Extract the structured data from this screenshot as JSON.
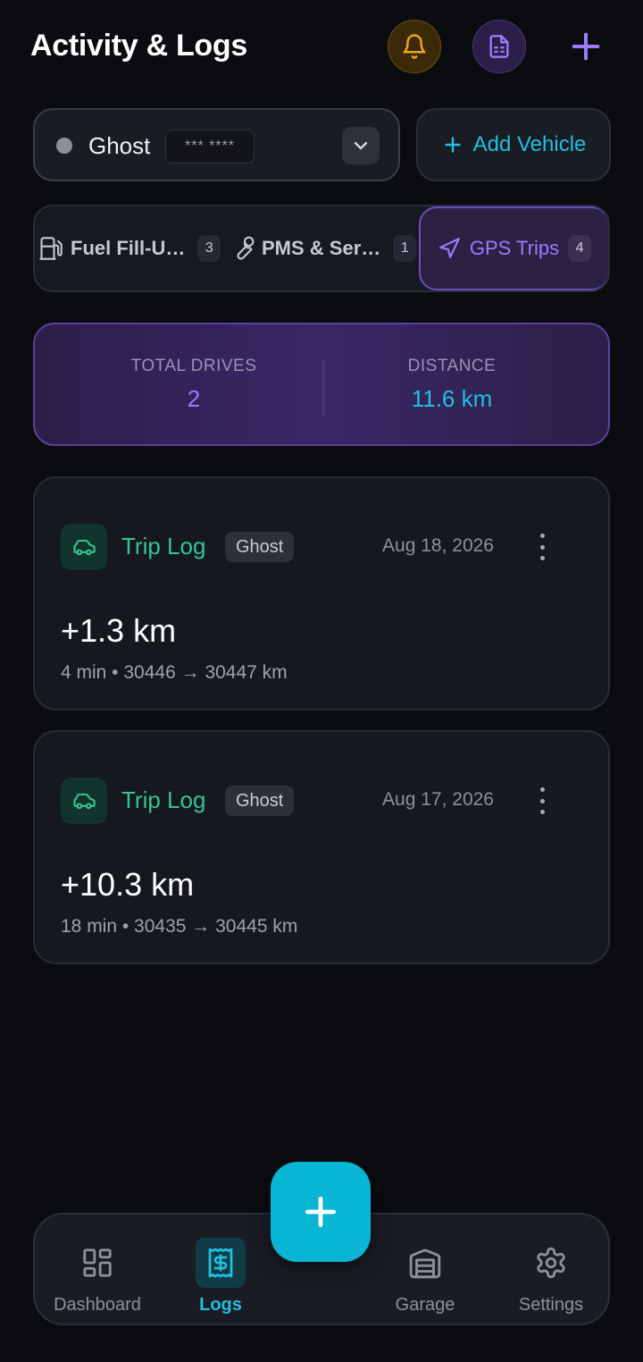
{
  "header": {
    "title": "Activity & Logs",
    "notifications_icon": "bell-icon",
    "reports_icon": "document-icon",
    "add_icon": "plus-icon"
  },
  "vehicle": {
    "name": "Ghost",
    "plate": "*** ****",
    "status_color": "#8d8f9a",
    "dropdown_icon": "chevron-down-icon"
  },
  "add_vehicle": {
    "label": "Add Vehicle"
  },
  "tabs": [
    {
      "label": "Fuel Fill-U…",
      "count": "3",
      "icon": "fuel-pump-icon",
      "active": false
    },
    {
      "label": "PMS & Ser…",
      "count": "1",
      "icon": "wrench-icon",
      "active": false
    },
    {
      "label": "GPS Trips",
      "count": "4",
      "icon": "navigation-arrow-icon",
      "active": true
    }
  ],
  "stats": {
    "total_drives_label": "TOTAL DRIVES",
    "total_drives_value": "2",
    "distance_label": "DISTANCE",
    "distance_value": "11.6 km"
  },
  "trips": [
    {
      "title": "Trip Log",
      "vehicle": "Ghost",
      "date": "Aug 18, 2026",
      "distance": "+1.3 km",
      "details": "4 min • 30446 → 30447 km"
    },
    {
      "title": "Trip Log",
      "vehicle": "Ghost",
      "date": "Aug 17, 2026",
      "distance": "+10.3 km",
      "details": "18 min • 30435 → 30445 km"
    }
  ],
  "nav": {
    "dashboard": "Dashboard",
    "logs": "Logs",
    "garage": "Garage",
    "settings": "Settings",
    "active": "logs"
  },
  "colors": {
    "accent_cyan": "#1fc0e0",
    "accent_purple": "#9d7bff",
    "trip_green": "#34c58f",
    "bell_amber": "#f0a21c"
  }
}
